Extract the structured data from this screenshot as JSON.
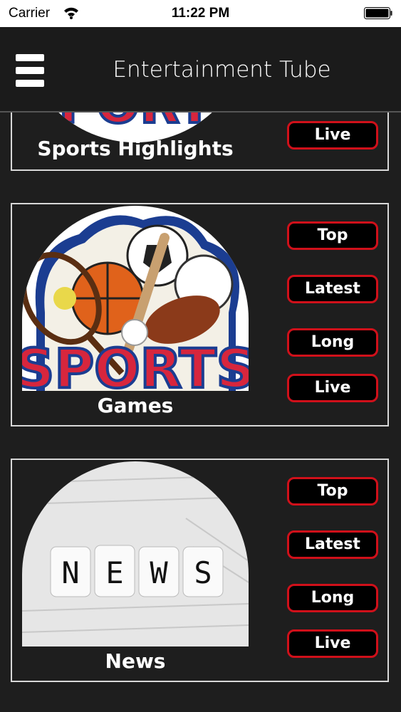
{
  "status_bar": {
    "carrier": "Carrier",
    "time": "11:22 PM"
  },
  "navbar": {
    "title": "Entertainment Tube",
    "menu_icon": "hamburger-menu-icon"
  },
  "cards": [
    {
      "label": "Sports Highlights",
      "buttons": [
        "Live"
      ]
    },
    {
      "label": "Games",
      "buttons": [
        "Top",
        "Latest",
        "Long",
        "Live"
      ]
    },
    {
      "label": "News",
      "buttons": [
        "Top",
        "Latest",
        "Long",
        "Live"
      ]
    }
  ],
  "thumb_letters": {
    "news_dice": [
      "N",
      "E",
      "W",
      "S"
    ]
  },
  "colors": {
    "button_border": "#d0101a",
    "background": "#1e1e1e",
    "card_border": "#d8d8d8"
  }
}
